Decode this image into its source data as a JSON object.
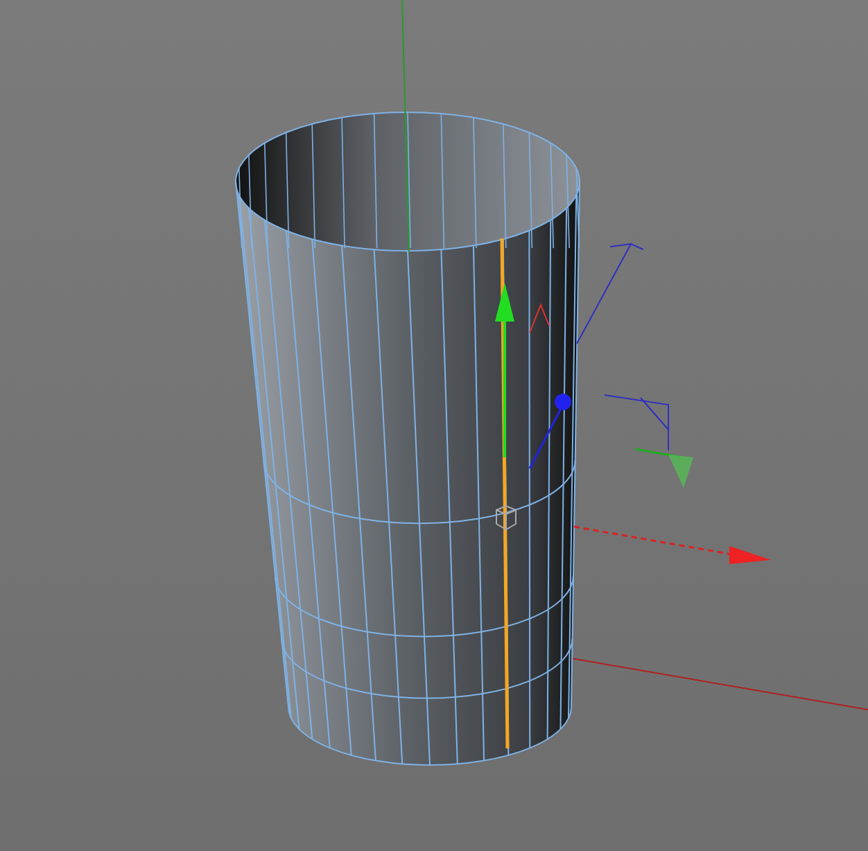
{
  "viewport": {
    "edge_selected": true
  }
}
